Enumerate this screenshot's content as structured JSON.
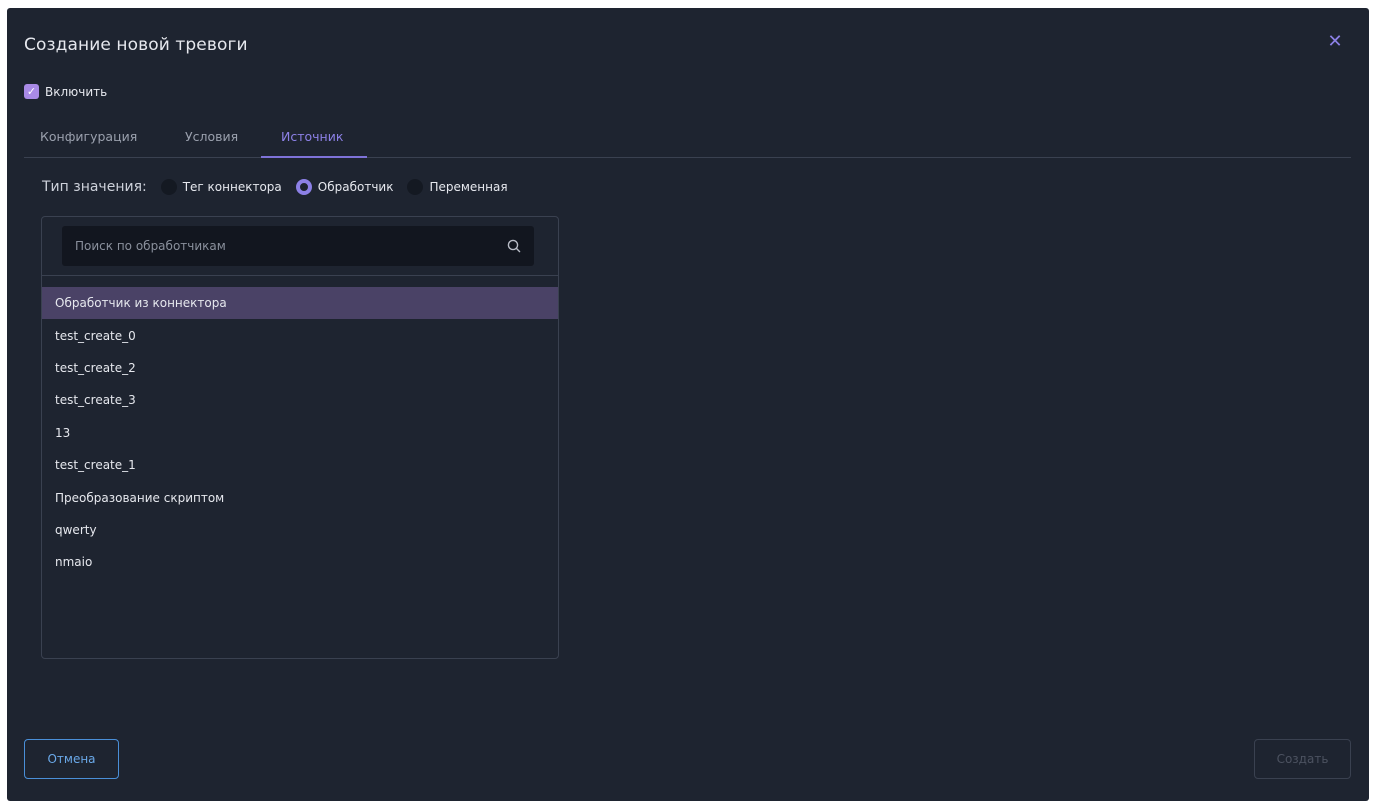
{
  "dialog": {
    "title": "Создание новой тревоги",
    "close_icon": "close-icon"
  },
  "enable": {
    "label": "Включить",
    "checked": true
  },
  "tabs": [
    {
      "label": "Конфигурация",
      "active": false
    },
    {
      "label": "Условия",
      "active": false
    },
    {
      "label": "Источник",
      "active": true
    }
  ],
  "value_type": {
    "label": "Тип значения:",
    "options": [
      {
        "label": "Тег коннектора",
        "selected": false
      },
      {
        "label": "Обработчик",
        "selected": true
      },
      {
        "label": "Переменная",
        "selected": false
      }
    ]
  },
  "search": {
    "placeholder": "Поиск по обработчикам",
    "value": "",
    "icon": "search-icon"
  },
  "handlers": [
    {
      "label": "Обработчик из коннектора",
      "selected": true
    },
    {
      "label": "test_create_0",
      "selected": false
    },
    {
      "label": "test_create_2",
      "selected": false
    },
    {
      "label": "test_create_3",
      "selected": false
    },
    {
      "label": "13",
      "selected": false
    },
    {
      "label": "test_create_1",
      "selected": false
    },
    {
      "label": "Преобразование скриптом",
      "selected": false
    },
    {
      "label": "qwerty",
      "selected": false
    },
    {
      "label": "nmaio",
      "selected": false
    }
  ],
  "footer": {
    "cancel_label": "Отмена",
    "create_label": "Создать",
    "create_disabled": true
  },
  "colors": {
    "background": "#1e2430",
    "accent": "#8c80e6",
    "selected_row": "#4a4266",
    "cancel_border": "#4a8fd8"
  }
}
